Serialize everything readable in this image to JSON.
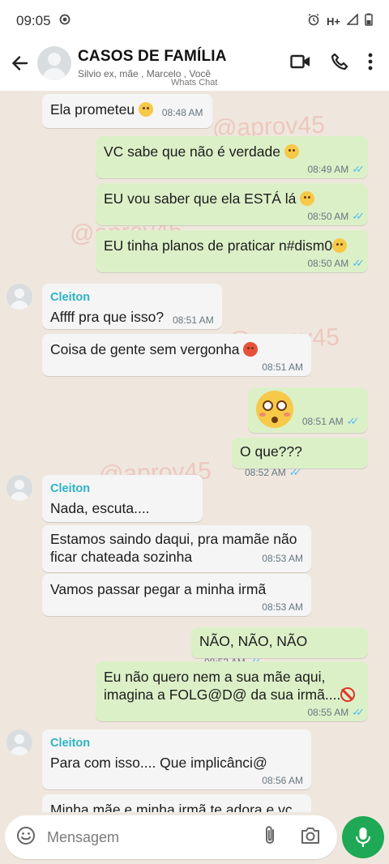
{
  "status_bar": {
    "time": "09:05",
    "network": "H+"
  },
  "header": {
    "title": "CASOS DE FAMÍLIA",
    "subtitle": "Silvio ex, mãe , Marcelo , Você",
    "watermark_tag": "Whats Chat"
  },
  "watermarks": [
    "@aprov45",
    "@aprov45",
    "@aprov45",
    "@aprov45"
  ],
  "messages": [
    {
      "dir": "in",
      "text": "Ela prometeu",
      "emoji": "smiling-face",
      "time": "08:48 AM"
    },
    {
      "dir": "out",
      "text": "VC sabe que não é verdade",
      "emoji": "raised-eyebrow-face",
      "time": "08:49 AM"
    },
    {
      "dir": "out",
      "text": "EU vou saber que ela ESTÁ lá",
      "emoji": "eye-roll-face",
      "time": "08:50 AM"
    },
    {
      "dir": "out",
      "text": "EU tinha planos de praticar n#dism0",
      "emoji": "steam-face",
      "time": "08:50 AM"
    },
    {
      "dir": "in",
      "sender": "Cleiton",
      "text": "Affff pra que isso?",
      "time": "08:51 AM"
    },
    {
      "dir": "in",
      "text": "Coisa de gente sem vergonha",
      "emoji": "angry-face",
      "time": "08:51 AM"
    },
    {
      "dir": "out",
      "text": "",
      "emoji": "flushed-face",
      "time": "08:51 AM"
    },
    {
      "dir": "out",
      "text": "O que???",
      "time": "08:52 AM"
    },
    {
      "dir": "in",
      "sender": "Cleiton",
      "text": "Nada, escuta....",
      "time": "08:52 AM"
    },
    {
      "dir": "in",
      "text_line1": "Estamos saindo daqui, pra mamãe não",
      "text_line2": "ficar chateada sozinha",
      "time": "08:53 AM"
    },
    {
      "dir": "in",
      "text": "Vamos passar pegar a minha irmã",
      "time": "08:53 AM"
    },
    {
      "dir": "out",
      "text": "NÃO, NÃO, NÃO",
      "time": "08:53 AM"
    },
    {
      "dir": "out",
      "text_line1": "Eu não quero nem a sua mãe aqui,",
      "text_line2": "imagina a FOLG@D@ da sua irmã....",
      "emoji": "prohibited-icon",
      "time": "08:55 AM"
    },
    {
      "dir": "in",
      "sender": "Cleiton",
      "text": "Para com isso.... Que implicânci@",
      "time": "08:56 AM"
    },
    {
      "dir": "in",
      "text": "Minha mãe e minha irmã te adora e vc",
      "time": ""
    }
  ],
  "input": {
    "placeholder": "Mensagem"
  },
  "colors": {
    "outgoing_bubble": "#dcf0c8",
    "incoming_bubble": "#f5f5f5",
    "sender_name": "#2bb3c5",
    "send_button": "#1fa855",
    "read_ticks": "#53bdeb"
  }
}
